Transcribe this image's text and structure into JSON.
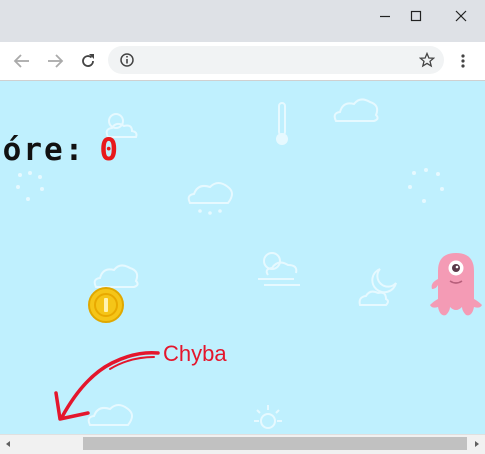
{
  "game": {
    "score_label": "córe:",
    "score_value": "0"
  },
  "annotation": {
    "text": "Chyba",
    "color": "#e4162c"
  },
  "colors": {
    "sky": "#bff0fe",
    "coin": "#f5c518",
    "monster": "#f49bb5",
    "score_value": "#e8191b"
  },
  "icons": {
    "back": "arrow-left-icon",
    "forward": "arrow-right-icon",
    "reload": "reload-icon",
    "info": "info-icon",
    "bookmark": "star-icon",
    "menu": "kebab-menu-icon",
    "minimize": "minimize-icon",
    "maximize": "maximize-icon",
    "close": "close-icon"
  }
}
